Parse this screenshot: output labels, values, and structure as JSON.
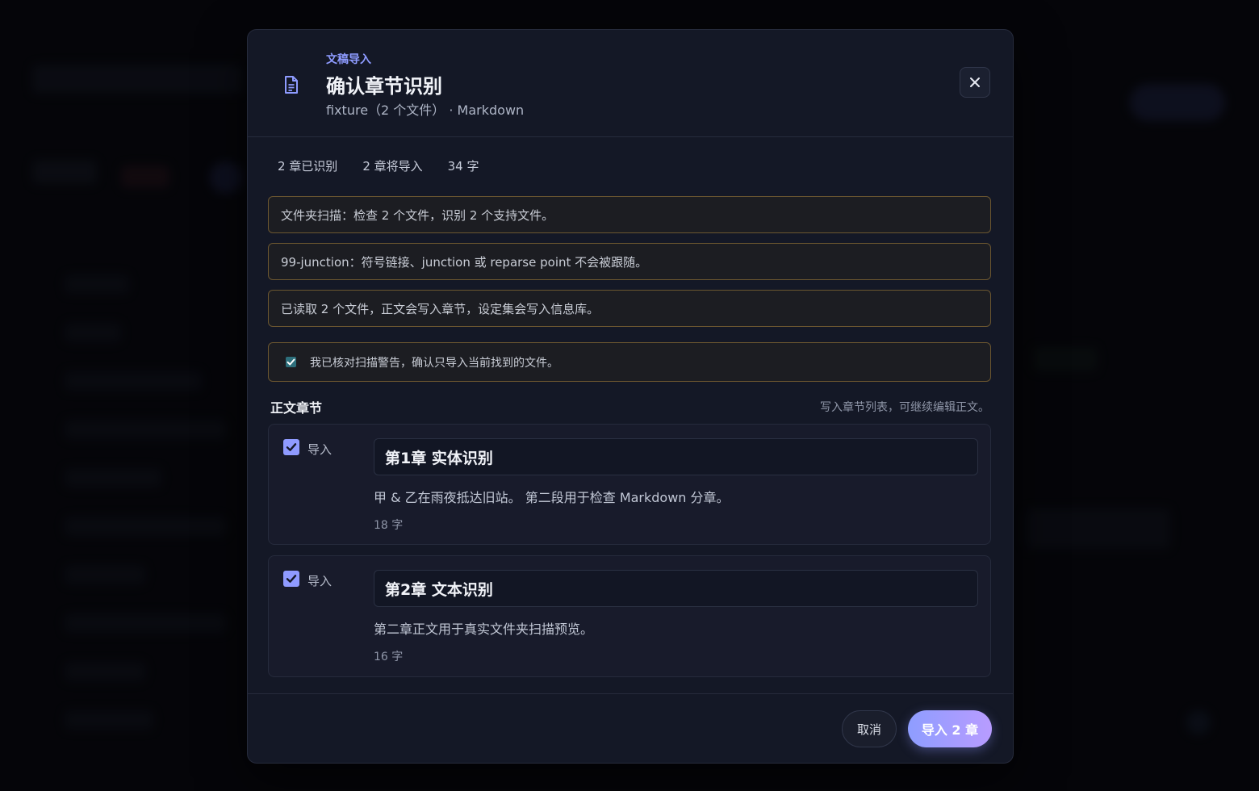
{
  "header": {
    "eyebrow": "文稿导入",
    "title": "确认章节识别",
    "subtitle": "fixture（2 个文件） · Markdown"
  },
  "stats": [
    "2 章已识别",
    "2 章将导入",
    "34 字"
  ],
  "notices": [
    "文件夹扫描：检查 2 个文件，识别 2 个支持文件。",
    "99-junction：符号链接、junction 或 reparse point 不会被跟随。",
    "已读取 2 个文件，正文会写入章节，设定集会写入信息库。"
  ],
  "confirm": {
    "checked": true,
    "label": "我已核对扫描警告，确认只导入当前找到的文件。"
  },
  "section": {
    "title": "正文章节",
    "hint": "写入章节列表，可继续编辑正文。"
  },
  "chapters": [
    {
      "checked": true,
      "import_label": "导入",
      "title": "第1章 实体识别",
      "body": "甲 & 乙在雨夜抵达旧站。 第二段用于检查 Markdown 分章。",
      "count": "18 字"
    },
    {
      "checked": true,
      "import_label": "导入",
      "title": "第2章 文本识别",
      "body": "第二章正文用于真实文件夹扫描预览。",
      "count": "16 字"
    }
  ],
  "footer": {
    "cancel_label": "取消",
    "import_label": "导入 2 章"
  },
  "colors": {
    "accent": "#8e9bff",
    "warning_border": "#6b5630",
    "modal_bg": "#141826"
  },
  "icons": {
    "header": "document-icon",
    "close": "close-icon",
    "check": "check-icon"
  }
}
